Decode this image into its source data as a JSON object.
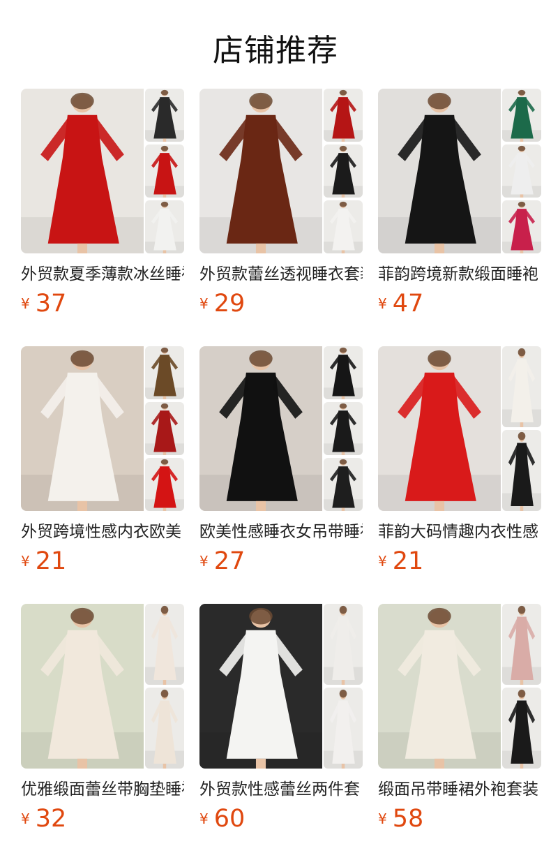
{
  "section": {
    "title": "店铺推荐"
  },
  "products": [
    {
      "title": "外贸款夏季薄款冰丝睡袍",
      "currency": "¥",
      "price": "37",
      "layout": "three",
      "colors": {
        "main_bg": "#e9e6e1",
        "main_dress": "#c81414",
        "side": [
          "#2a2a2a",
          "#c81414",
          "#f2f2f0"
        ]
      }
    },
    {
      "title": "外贸款蕾丝透视睡衣套装",
      "currency": "¥",
      "price": "29",
      "layout": "three",
      "colors": {
        "main_bg": "#e8e6e4",
        "main_dress": "#6a2714",
        "side": [
          "#b51515",
          "#1b1b1b",
          "#f3f2f0"
        ]
      }
    },
    {
      "title": "菲韵跨境新款缎面睡袍",
      "currency": "¥",
      "price": "47",
      "layout": "three",
      "colors": {
        "main_bg": "#e1dfdc",
        "main_dress": "#151515",
        "side": [
          "#1c6a4a",
          "#eeeeee",
          "#c8204b"
        ]
      }
    },
    {
      "title": "外贸跨境性感内衣欧美",
      "currency": "¥",
      "price": "21",
      "layout": "three",
      "colors": {
        "main_bg": "#d9cec2",
        "main_dress": "#f4f1ec",
        "side": [
          "#6b4a27",
          "#a81818",
          "#d41414"
        ]
      }
    },
    {
      "title": "欧美性感睡衣女吊带睡裙",
      "currency": "¥",
      "price": "27",
      "layout": "three",
      "colors": {
        "main_bg": "#d6cfc8",
        "main_dress": "#111111",
        "side": [
          "#161616",
          "#1a1a1a",
          "#1e1e1e"
        ]
      }
    },
    {
      "title": "菲韵大码情趣内衣性感",
      "currency": "¥",
      "price": "21",
      "layout": "two",
      "colors": {
        "main_bg": "#e4e0dc",
        "main_dress": "#d91a1a",
        "side": [
          "#f3f0ea",
          "#1a1a1a"
        ]
      }
    },
    {
      "title": "优雅缎面蕾丝带胸垫睡裙",
      "currency": "¥",
      "price": "32",
      "layout": "two",
      "colors": {
        "main_bg": "#d8dcc8",
        "main_dress": "#f1e8dc",
        "side": [
          "#f0e6dc",
          "#eee4d8"
        ]
      }
    },
    {
      "title": "外贸款性感蕾丝两件套",
      "currency": "¥",
      "price": "60",
      "layout": "two",
      "colors": {
        "main_bg": "#2a2a2a",
        "main_dress": "#f4f4f2",
        "side": [
          "#efedea",
          "#f2f0ee"
        ]
      }
    },
    {
      "title": "缎面吊带睡裙外袍套装",
      "currency": "¥",
      "price": "58",
      "layout": "two",
      "colors": {
        "main_bg": "#d9dccd",
        "main_dress": "#f1ebe0",
        "side": [
          "#d9aca7",
          "#1a1a1a"
        ]
      }
    }
  ]
}
